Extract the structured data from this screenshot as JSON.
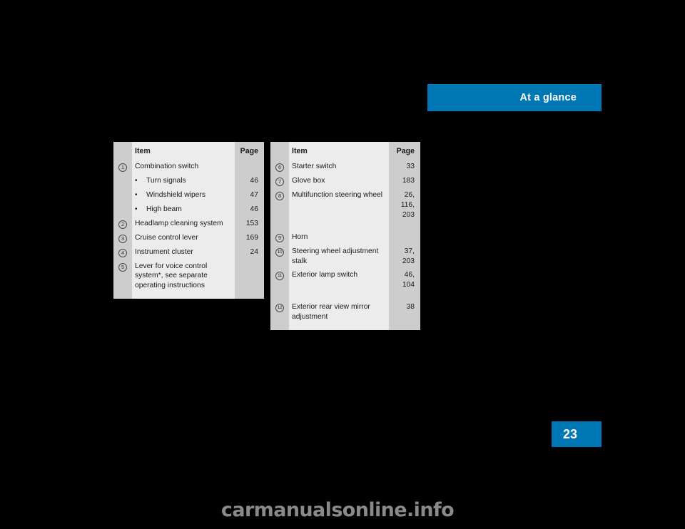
{
  "header": {
    "title": "At a glance",
    "accent_color": "#0077B5"
  },
  "page_number": "23",
  "watermark": "carmanualsonline.info",
  "tables": [
    {
      "id": "table-1",
      "columns": {
        "marker": "",
        "item": "Item",
        "page": "Page"
      },
      "rows": [
        {
          "marker": "1",
          "item": "Combination switch",
          "page": ""
        },
        {
          "marker": "",
          "bullet": true,
          "item": "Turn signals",
          "page": "46"
        },
        {
          "marker": "",
          "bullet": true,
          "item": "Windshield wipers",
          "page": "47"
        },
        {
          "marker": "",
          "bullet": true,
          "item": "High beam",
          "page": "46"
        },
        {
          "marker": "2",
          "item": "Headlamp cleaning system",
          "page": "153"
        },
        {
          "marker": "3",
          "item": "Cruise control lever",
          "page": "169"
        },
        {
          "marker": "4",
          "item": "Instrument cluster",
          "page": "24"
        },
        {
          "marker": "5",
          "item": "Lever for voice control system*, see separate operating instructions",
          "page": ""
        }
      ]
    },
    {
      "id": "table-2",
      "columns": {
        "marker": "",
        "item": "Item",
        "page": "Page"
      },
      "rows": [
        {
          "marker": "6",
          "item": "Starter switch",
          "page": "33"
        },
        {
          "marker": "7",
          "item": "Glove box",
          "page": "183"
        },
        {
          "marker": "8",
          "item": "Multifunction steering wheel",
          "page": "26,\n116,\n203"
        },
        {
          "marker": "9",
          "item": "Horn",
          "page": ""
        },
        {
          "marker": "10",
          "item": "Steering wheel adjustment stalk",
          "page": "37,\n203"
        },
        {
          "marker": "11",
          "item": "Exterior lamp switch",
          "page": "46,\n104"
        },
        {
          "marker": "12",
          "item": "Exterior rear view mirror adjustment",
          "page": "38"
        }
      ]
    }
  ],
  "colors": {
    "page_background": "#000000",
    "table_item_background": "#ececec",
    "table_side_background": "#cdcdcd",
    "accent_blue": "#0077B5",
    "watermark_gray": "#8a8a8a"
  }
}
